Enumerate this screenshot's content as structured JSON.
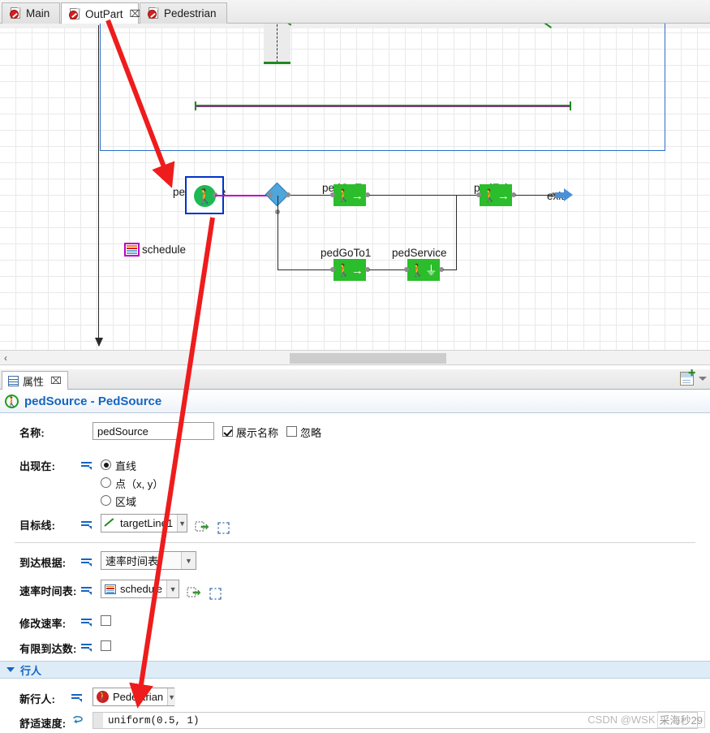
{
  "tabs": [
    {
      "label": "Main",
      "icon": "document-red-badge-icon",
      "active": false,
      "closable": false
    },
    {
      "label": "OutPart",
      "icon": "document-red-badge-icon",
      "active": true,
      "closable": true,
      "close_glyph": "⌧"
    },
    {
      "label": "Pedestrian",
      "icon": "document-red-badge-icon",
      "active": false,
      "closable": false
    }
  ],
  "canvas": {
    "nodes": [
      {
        "name": "pedSource",
        "label": "pedSource",
        "type": "ped-source",
        "selected": true
      },
      {
        "name": "pedGoTo",
        "label": "pedGoTo",
        "type": "ped-goto"
      },
      {
        "name": "pedGoTo1",
        "label": "pedGoTo1",
        "type": "ped-goto"
      },
      {
        "name": "pedService",
        "label": "pedService",
        "type": "ped-service"
      },
      {
        "name": "pedExit",
        "label": "pedExit",
        "type": "ped-exit"
      },
      {
        "name": "exit",
        "label": "exit",
        "type": "exit-arrow"
      },
      {
        "name": "schedule",
        "label": "schedule",
        "type": "schedule",
        "selected": true
      }
    ],
    "scrollbar": {
      "left_arrow": "‹"
    }
  },
  "properties_view": {
    "tab_label": "属性",
    "tab_close_glyph": "⌧",
    "view_menu_glyph": "▾",
    "title": "pedSource - PedSource",
    "fields": {
      "name_label": "名称:",
      "name_value": "pedSource",
      "show_name_label": "展示名称",
      "show_name_checked": true,
      "ignore_label": "忽略",
      "ignore_checked": false,
      "appears_in_label": "出现在:",
      "appears_in_options": [
        "直线",
        "点（x, y）",
        "区域"
      ],
      "appears_in_selected": "直线",
      "target_line_label": "目标线:",
      "target_line_value": "targetLine1",
      "arrival_basis_label": "到达根据:",
      "arrival_basis_value": "速率时间表",
      "rate_schedule_label": "速率时间表:",
      "rate_schedule_value": "schedule",
      "modify_rate_label": "修改速率:",
      "modify_rate_checked": false,
      "limited_arrivals_label": "有限到达数:",
      "limited_arrivals_checked": false
    },
    "pedestrian_section": {
      "header": "行人",
      "new_ped_label": "新行人:",
      "new_ped_value": "Pedestrian",
      "comfort_speed_label": "舒适速度:",
      "comfort_speed_value": "uniform(0.5, 1)"
    }
  },
  "watermark": {
    "prefix": "CSDN @WSK",
    "suffix": "采海秒29"
  },
  "colors": {
    "accent_blue": "#1565c0",
    "node_green": "#2bbd2b",
    "selection_blue": "#0033cc",
    "link_magenta": "#c000c0",
    "annotation_red": "#ee1c1c",
    "section_bg": "#deecf7"
  }
}
